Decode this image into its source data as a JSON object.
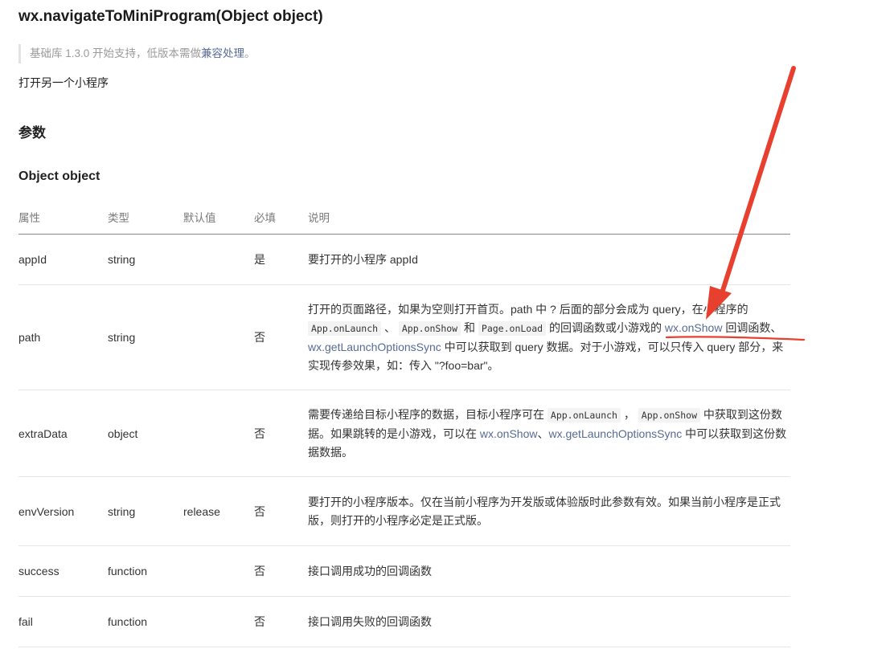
{
  "header": {
    "title": "wx.navigateToMiniProgram(Object object)",
    "note_prefix": "基础库 1.3.0 开始支持，低版本需做",
    "note_link": "兼容处理",
    "note_suffix": "。",
    "description": "打开另一个小程序",
    "params_heading": "参数",
    "object_heading": "Object object"
  },
  "table": {
    "headers": [
      "属性",
      "类型",
      "默认值",
      "必填",
      "说明"
    ],
    "rows": [
      {
        "name": "appId",
        "type": "string",
        "default": "",
        "required": "是",
        "desc": [
          {
            "t": "text",
            "v": "要打开的小程序 appId"
          }
        ]
      },
      {
        "name": "path",
        "type": "string",
        "default": "",
        "required": "否",
        "desc": [
          {
            "t": "text",
            "v": "打开的页面路径，如果为空则打开首页。path 中 ? 后面的部分会成为 query，在小程序的 "
          },
          {
            "t": "code",
            "v": "App.onLaunch"
          },
          {
            "t": "text",
            "v": " 、 "
          },
          {
            "t": "code",
            "v": "App.onShow"
          },
          {
            "t": "text",
            "v": " 和 "
          },
          {
            "t": "code",
            "v": "Page.onLoad"
          },
          {
            "t": "text",
            "v": " 的回调函数或小游戏的 "
          },
          {
            "t": "link",
            "v": "wx.onShow"
          },
          {
            "t": "text",
            "v": " 回调函数、"
          },
          {
            "t": "link",
            "v": "wx.getLaunchOptionsSync"
          },
          {
            "t": "text",
            "v": " 中可以获取到 query 数据。对于小游戏，可以只传入 query 部分，来实现传参效果，如：传入 \"?foo=bar\"。"
          }
        ]
      },
      {
        "name": "extraData",
        "type": "object",
        "default": "",
        "required": "否",
        "desc": [
          {
            "t": "text",
            "v": "需要传递给目标小程序的数据，目标小程序可在 "
          },
          {
            "t": "code",
            "v": "App.onLaunch"
          },
          {
            "t": "text",
            "v": " ， "
          },
          {
            "t": "code",
            "v": "App.onShow"
          },
          {
            "t": "text",
            "v": " 中获取到这份数据。如果跳转的是小游戏，可以在 "
          },
          {
            "t": "link",
            "v": "wx.onShow"
          },
          {
            "t": "text",
            "v": "、"
          },
          {
            "t": "link",
            "v": "wx.getLaunchOptionsSync"
          },
          {
            "t": "text",
            "v": " 中可以获取到这份数据数据。"
          }
        ]
      },
      {
        "name": "envVersion",
        "type": "string",
        "default": "release",
        "required": "否",
        "desc": [
          {
            "t": "text",
            "v": "要打开的小程序版本。仅在当前小程序为开发版或体验版时此参数有效。如果当前小程序是正式版，则打开的小程序必定是正式版。"
          }
        ]
      },
      {
        "name": "success",
        "type": "function",
        "default": "",
        "required": "否",
        "desc": [
          {
            "t": "text",
            "v": "接口调用成功的回调函数"
          }
        ]
      },
      {
        "name": "fail",
        "type": "function",
        "default": "",
        "required": "否",
        "desc": [
          {
            "t": "text",
            "v": "接口调用失败的回调函数"
          }
        ]
      }
    ]
  },
  "annotation": {
    "color": "#e8402f"
  }
}
